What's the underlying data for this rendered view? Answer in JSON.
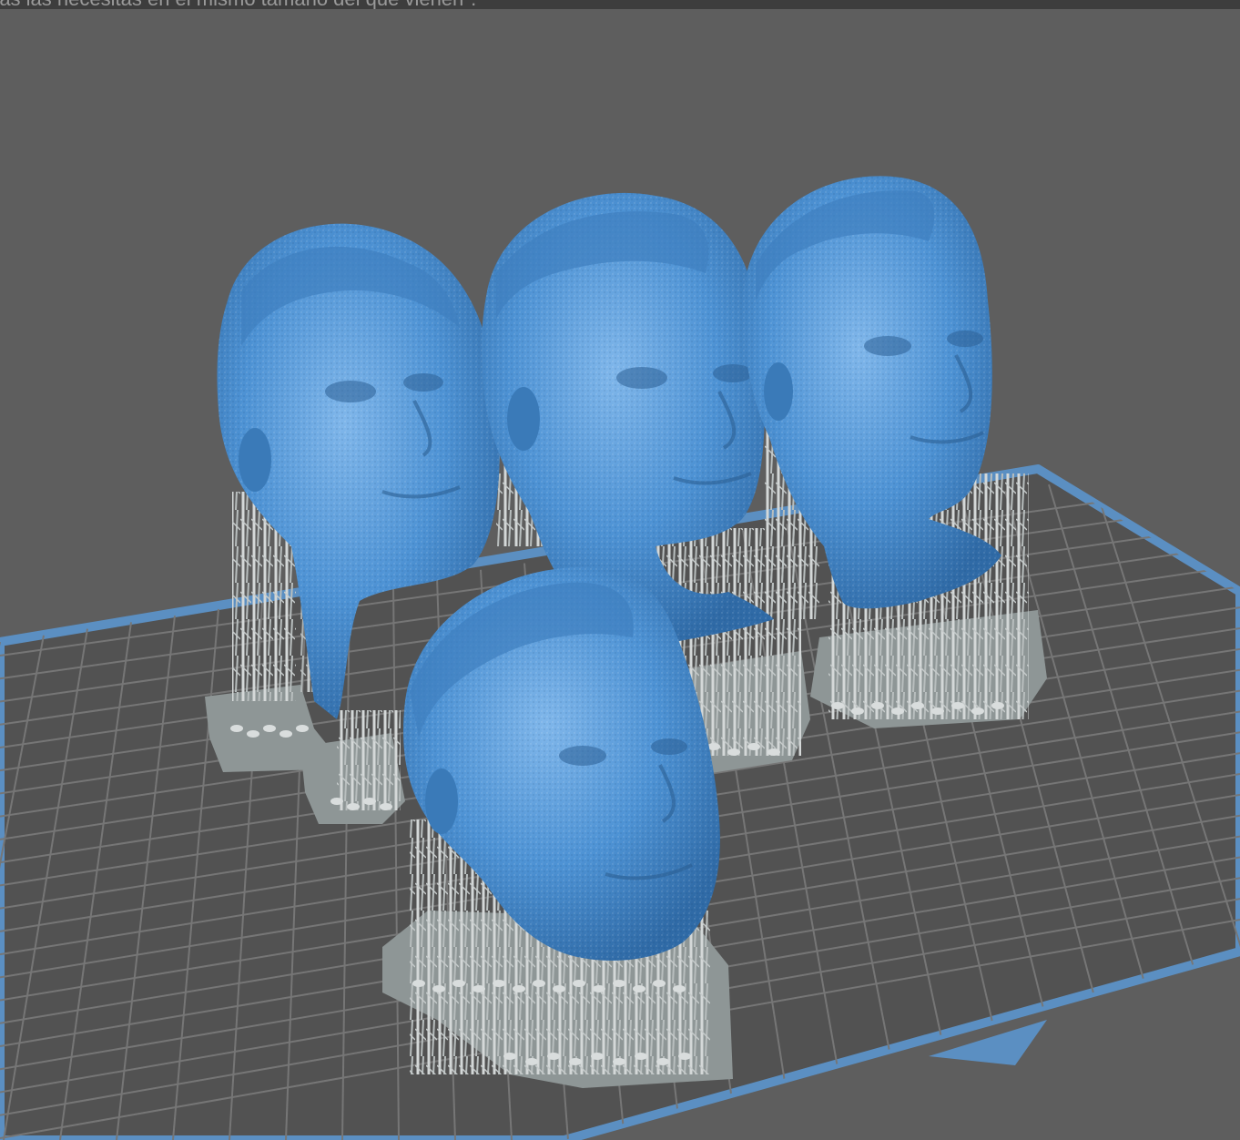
{
  "window": {
    "caption_text": "ras las necesitas en el mismo tamaño del que vienen\"."
  },
  "viewport": {
    "background_color": "#5e5e5e",
    "plate_border_color": "#5b8fc2",
    "plate_fill_color": "#525252",
    "grid_line_color": "#747474",
    "model_color": "#4d92d4",
    "support_color": "#c6cbcb",
    "raft_color": "#8e9696"
  },
  "models": [
    {
      "label": "head-model-back-left",
      "supported": true
    },
    {
      "label": "head-model-back-center",
      "supported": true
    },
    {
      "label": "head-model-back-right",
      "supported": true
    },
    {
      "label": "head-model-front",
      "supported": true
    }
  ]
}
